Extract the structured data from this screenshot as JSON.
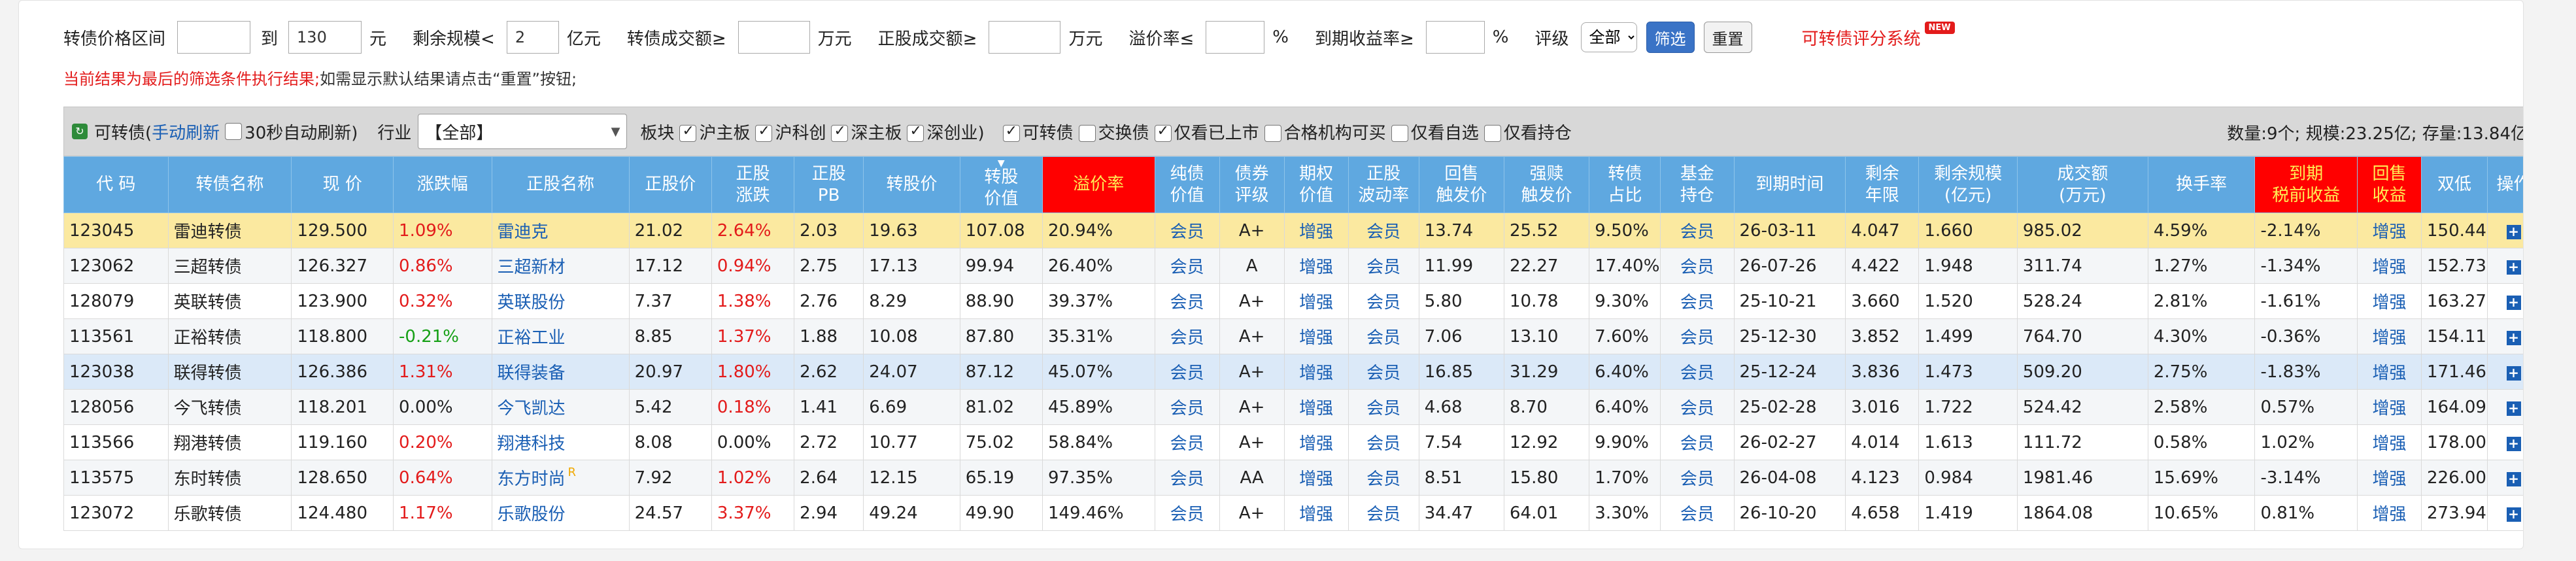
{
  "filter": {
    "price_label": "转债价格区间",
    "price_min": "",
    "to_label": "到",
    "price_max": "130",
    "price_unit": "元",
    "scale_label": "剩余规模<",
    "scale_value": "2",
    "scale_unit": "亿元",
    "cb_amount_label": "转债成交额≥",
    "cb_amount_value": "",
    "wan_unit": "万元",
    "stock_amount_label": "正股成交额≥",
    "stock_amount_value": "",
    "premium_label": "溢价率≤",
    "premium_value": "",
    "pct_unit": "%",
    "ytm_label": "到期收益率≥",
    "ytm_value": "",
    "rating_label": "评级",
    "rating_selected": "全部",
    "filter_button": "筛选",
    "reset_button": "重置",
    "score_link": "可转债评分系统",
    "new_badge": "NEW"
  },
  "notice": {
    "red": "当前结果为最后的筛选条件执行结果;",
    "rest": "如需显示默认结果请点击“重置”按钮;"
  },
  "toolbar": {
    "title": "可转债(",
    "manual_refresh": "手动刷新",
    "title_close": ")",
    "auto_refresh": "30秒自动刷新)",
    "industry_label": "行业",
    "industry_selected": "【全部】",
    "board_label": "板块",
    "boards": [
      {
        "label": "沪主板",
        "checked": true
      },
      {
        "label": "沪科创",
        "checked": true
      },
      {
        "label": "深主板",
        "checked": true
      },
      {
        "label": "深创业)",
        "checked": true
      }
    ],
    "options": [
      {
        "label": "可转债",
        "checked": true
      },
      {
        "label": "交换债",
        "checked": false
      },
      {
        "label": "仅看已上市",
        "checked": true
      },
      {
        "label": "合格机构可买",
        "checked": false
      },
      {
        "label": "仅看自选",
        "checked": false
      },
      {
        "label": "仅看持仓",
        "checked": false
      }
    ],
    "summary": "数量:9个; 规模:23.25亿; 存量:13.84亿"
  },
  "table": {
    "headers": [
      "代 码",
      "转债名称",
      "现 价",
      "涨跌幅",
      "正股名称",
      "正股价",
      "正股\n涨跌",
      "正股\nPB",
      "转股价",
      "转股\n价值",
      "溢价率",
      "纯债\n价值",
      "债券\n评级",
      "期权\n价值",
      "正股\n波动率",
      "回售\n触发价",
      "强赎\n触发价",
      "转债\n占比",
      "基金\n持仓",
      "到期时间",
      "剩余\n年限",
      "剩余规模\n(亿元)",
      "成交额\n(万元)",
      "换手率",
      "到期\n税前收益",
      "回售\n收益",
      "双低",
      "操作"
    ],
    "rows": [
      [
        "123045",
        "雷迪转债",
        "129.500",
        "1.09%",
        "雷迪克",
        "21.02",
        "2.64%",
        "2.03",
        "19.63",
        "107.08",
        "20.94%",
        "会员",
        "A+",
        "增强",
        "会员",
        "13.74",
        "25.52",
        "9.50%",
        "会员",
        "26-03-11",
        "4.047",
        "1.660",
        "985.02",
        "4.59%",
        "-2.14%",
        "增强",
        "150.44"
      ],
      [
        "123062",
        "三超转债",
        "126.327",
        "0.86%",
        "三超新材",
        "17.12",
        "0.94%",
        "2.75",
        "17.13",
        "99.94",
        "26.40%",
        "会员",
        "A",
        "增强",
        "会员",
        "11.99",
        "22.27",
        "17.40%",
        "会员",
        "26-07-26",
        "4.422",
        "1.948",
        "311.74",
        "1.27%",
        "-1.34%",
        "增强",
        "152.73"
      ],
      [
        "128079",
        "英联转债",
        "123.900",
        "0.32%",
        "英联股份",
        "7.37",
        "1.38%",
        "2.76",
        "8.29",
        "88.90",
        "39.37%",
        "会员",
        "A+",
        "增强",
        "会员",
        "5.80",
        "10.78",
        "9.30%",
        "会员",
        "25-10-21",
        "3.660",
        "1.520",
        "528.24",
        "2.81%",
        "-1.61%",
        "增强",
        "163.27"
      ],
      [
        "113561",
        "正裕转债",
        "118.800",
        "-0.21%",
        "正裕工业",
        "8.85",
        "1.37%",
        "1.88",
        "10.08",
        "87.80",
        "35.31%",
        "会员",
        "A+",
        "增强",
        "会员",
        "7.06",
        "13.10",
        "7.60%",
        "会员",
        "25-12-30",
        "3.852",
        "1.499",
        "764.70",
        "4.30%",
        "-0.36%",
        "增强",
        "154.11"
      ],
      [
        "123038",
        "联得转债",
        "126.386",
        "1.31%",
        "联得装备",
        "20.97",
        "1.80%",
        "2.62",
        "24.07",
        "87.12",
        "45.07%",
        "会员",
        "A+",
        "增强",
        "会员",
        "16.85",
        "31.29",
        "6.40%",
        "会员",
        "25-12-24",
        "3.836",
        "1.473",
        "509.20",
        "2.75%",
        "-1.83%",
        "增强",
        "171.46"
      ],
      [
        "128056",
        "今飞转债",
        "118.201",
        "0.00%",
        "今飞凯达",
        "5.42",
        "0.18%",
        "1.41",
        "6.69",
        "81.02",
        "45.89%",
        "会员",
        "A+",
        "增强",
        "会员",
        "4.68",
        "8.70",
        "6.40%",
        "会员",
        "25-02-28",
        "3.016",
        "1.722",
        "524.42",
        "2.58%",
        "0.57%",
        "增强",
        "164.09"
      ],
      [
        "113566",
        "翔港转债",
        "119.160",
        "0.20%",
        "翔港科技",
        "8.08",
        "0.00%",
        "2.72",
        "10.77",
        "75.02",
        "58.84%",
        "会员",
        "A+",
        "增强",
        "会员",
        "7.54",
        "12.92",
        "9.90%",
        "会员",
        "26-02-27",
        "4.014",
        "1.613",
        "111.72",
        "0.58%",
        "1.02%",
        "增强",
        "178.00"
      ],
      [
        "113575",
        "东时转债",
        "128.650",
        "0.64%",
        "东方时尚",
        "7.92",
        "1.02%",
        "2.64",
        "12.15",
        "65.19",
        "97.35%",
        "会员",
        "AA",
        "增强",
        "会员",
        "8.51",
        "15.80",
        "1.70%",
        "会员",
        "26-04-08",
        "4.123",
        "0.984",
        "1981.46",
        "15.69%",
        "-3.14%",
        "增强",
        "226.00"
      ],
      [
        "123072",
        "乐歌转债",
        "124.480",
        "1.17%",
        "乐歌股份",
        "24.57",
        "3.37%",
        "2.94",
        "49.24",
        "49.90",
        "149.46%",
        "会员",
        "A+",
        "增强",
        "会员",
        "34.47",
        "64.01",
        "3.30%",
        "会员",
        "26-10-20",
        "4.658",
        "1.419",
        "1864.08",
        "10.65%",
        "0.81%",
        "增强",
        "273.94"
      ]
    ],
    "r_mark": "R",
    "action_icon": "plus-icon",
    "colors": {
      "up": "#e31b1b",
      "down": "#16a016",
      "link": "#1a5fb4",
      "header": "#5fa8e0",
      "highlight": "#fbe9a0"
    }
  }
}
